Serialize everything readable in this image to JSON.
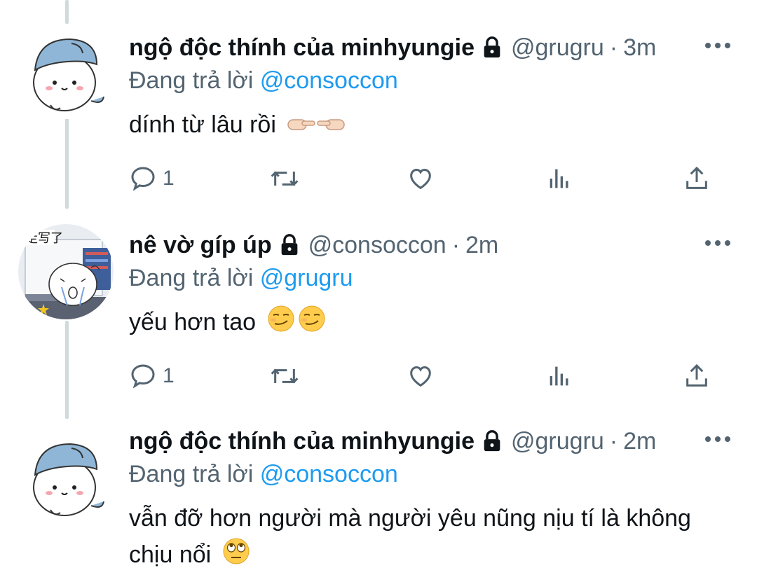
{
  "tweets": [
    {
      "display_name": "ngộ độc thính của minhyungie",
      "handle": "@grugru",
      "separator": "·",
      "time": "3m",
      "reply_prefix": "Đang trả lời",
      "reply_to": "@consoccon",
      "body": "dính từ lâu rồi",
      "emoji": "pointing-hands-emoji",
      "reply_count": "1",
      "avatar": "white-creature-blue-hat-avatar"
    },
    {
      "display_name": "nê vờ gíp úp",
      "handle": "@consoccon",
      "separator": "·",
      "time": "2m",
      "reply_prefix": "Đang trả lời",
      "reply_to": "@grugru",
      "body": "yếu hơn tao",
      "emoji": "smirking-face-emoji",
      "reply_count": "1",
      "avatar": "crying-creature-sketch-avatar",
      "avatar_text": "走写了"
    },
    {
      "display_name": "ngộ độc thính của minhyungie",
      "handle": "@grugru",
      "separator": "·",
      "time": "2m",
      "reply_prefix": "Đang trả lời",
      "reply_to": "@consoccon",
      "body_line1": "vẫn đỡ hơn người mà người yêu nũng nịu tí là không",
      "body_line2": "chịu nổi",
      "emoji": "eye-roll-emoji",
      "avatar": "white-creature-blue-hat-avatar"
    }
  ],
  "colors": {
    "text": "#0f1419",
    "secondary": "#536471",
    "link": "#1d9bf0",
    "thread_line": "#cfd9de",
    "avatar_hat": "#8fb6d6"
  }
}
